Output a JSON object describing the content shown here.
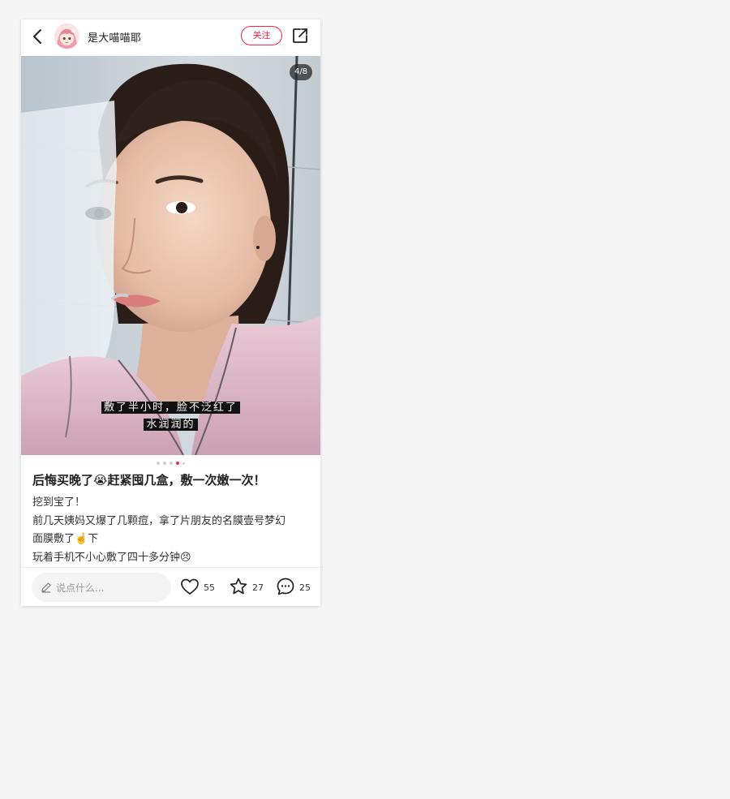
{
  "header": {
    "author_name": "是大喵喵耶",
    "follow_label": "关注"
  },
  "photo": {
    "counter": "4/8",
    "subtitle_line1": "敷了半小时，脸不泛红了",
    "subtitle_line2": "水润润的",
    "pagination": {
      "total": 5,
      "active_index": 3
    }
  },
  "post": {
    "title": "后悔买晚了😭赶紧囤几盒，敷一次嫩一次！",
    "lines": [
      "挖到宝了！",
      "前几天姨妈又爆了几颗痘，拿了片朋友的名膜壹号梦幻",
      "面膜敷了☝️下",
      "玩着手机不小心敷了四十多分钟😣"
    ]
  },
  "footer": {
    "comment_placeholder": "说点什么...",
    "likes": "55",
    "stars": "27",
    "comments": "25"
  },
  "colors": {
    "accent": "#ff2442",
    "background": "#f5f5f5"
  },
  "icons": [
    "back-arrow-icon",
    "share-icon",
    "pen-icon",
    "heart-icon",
    "star-icon",
    "comment-icon"
  ]
}
